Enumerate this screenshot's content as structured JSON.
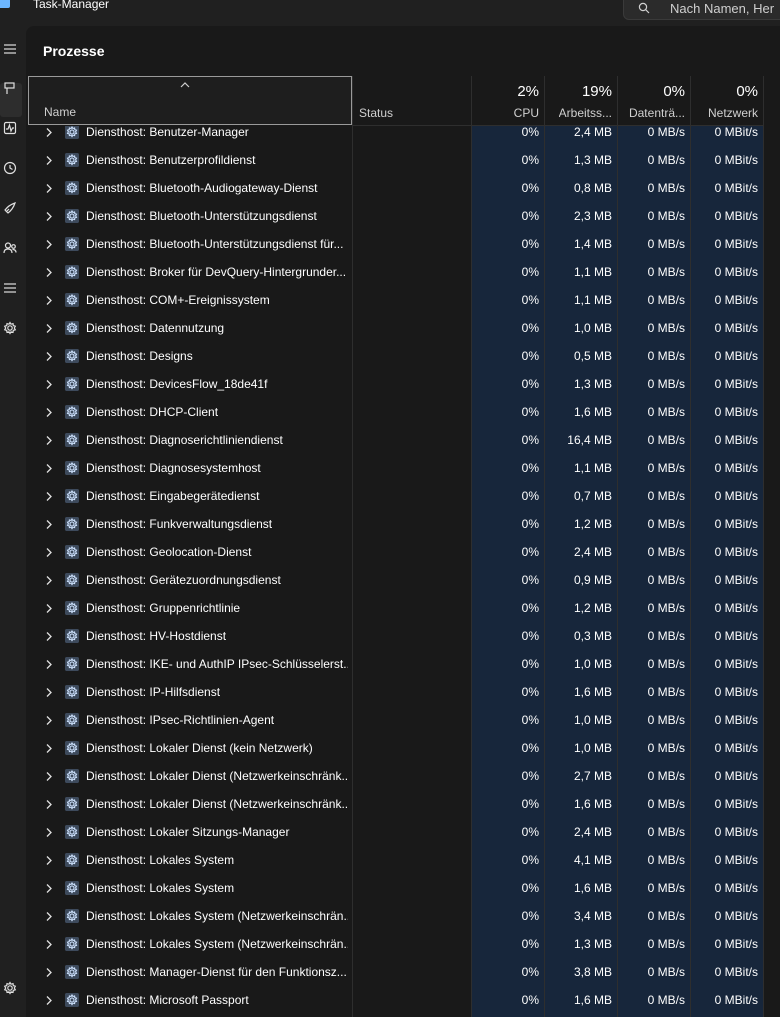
{
  "window": {
    "title": "Task-Manager"
  },
  "search": {
    "placeholder": "Nach Namen, Her"
  },
  "nav": {
    "items": [
      "menu",
      "processes",
      "performance",
      "app-history",
      "startup",
      "users",
      "details",
      "services"
    ],
    "settings": "settings"
  },
  "page": {
    "title": "Prozesse"
  },
  "columns": {
    "name": "Name",
    "status": "Status",
    "cpu": {
      "label": "CPU",
      "pct": "2%"
    },
    "memory": {
      "label": "Arbeitss...",
      "pct": "19%"
    },
    "disk": {
      "label": "Datenträ...",
      "pct": "0%"
    },
    "network": {
      "label": "Netzwerk",
      "pct": "0%"
    }
  },
  "colors": {
    "accent_metric_bg": "#17263b",
    "background": "#191919"
  },
  "rows": [
    {
      "name": "Diensthost: Benutzer-Manager",
      "cpu": "0%",
      "mem": "2,4 MB",
      "disk": "0 MB/s",
      "net": "0 MBit/s"
    },
    {
      "name": "Diensthost: Benutzerprofildienst",
      "cpu": "0%",
      "mem": "1,3 MB",
      "disk": "0 MB/s",
      "net": "0 MBit/s"
    },
    {
      "name": "Diensthost: Bluetooth-Audiogateway-Dienst",
      "cpu": "0%",
      "mem": "0,8 MB",
      "disk": "0 MB/s",
      "net": "0 MBit/s"
    },
    {
      "name": "Diensthost: Bluetooth-Unterstützungsdienst",
      "cpu": "0%",
      "mem": "2,3 MB",
      "disk": "0 MB/s",
      "net": "0 MBit/s"
    },
    {
      "name": "Diensthost: Bluetooth-Unterstützungsdienst für...",
      "cpu": "0%",
      "mem": "1,4 MB",
      "disk": "0 MB/s",
      "net": "0 MBit/s"
    },
    {
      "name": "Diensthost: Broker für DevQuery-Hintergrunder...",
      "cpu": "0%",
      "mem": "1,1 MB",
      "disk": "0 MB/s",
      "net": "0 MBit/s"
    },
    {
      "name": "Diensthost: COM+-Ereignissystem",
      "cpu": "0%",
      "mem": "1,1 MB",
      "disk": "0 MB/s",
      "net": "0 MBit/s"
    },
    {
      "name": "Diensthost: Datennutzung",
      "cpu": "0%",
      "mem": "1,0 MB",
      "disk": "0 MB/s",
      "net": "0 MBit/s"
    },
    {
      "name": "Diensthost: Designs",
      "cpu": "0%",
      "mem": "0,5 MB",
      "disk": "0 MB/s",
      "net": "0 MBit/s"
    },
    {
      "name": "Diensthost: DevicesFlow_18de41f",
      "cpu": "0%",
      "mem": "1,3 MB",
      "disk": "0 MB/s",
      "net": "0 MBit/s"
    },
    {
      "name": "Diensthost: DHCP-Client",
      "cpu": "0%",
      "mem": "1,6 MB",
      "disk": "0 MB/s",
      "net": "0 MBit/s"
    },
    {
      "name": "Diensthost: Diagnoserichtliniendienst",
      "cpu": "0%",
      "mem": "16,4 MB",
      "disk": "0 MB/s",
      "net": "0 MBit/s"
    },
    {
      "name": "Diensthost: Diagnosesystemhost",
      "cpu": "0%",
      "mem": "1,1 MB",
      "disk": "0 MB/s",
      "net": "0 MBit/s"
    },
    {
      "name": "Diensthost: Eingabegerätedienst",
      "cpu": "0%",
      "mem": "0,7 MB",
      "disk": "0 MB/s",
      "net": "0 MBit/s"
    },
    {
      "name": "Diensthost: Funkverwaltungsdienst",
      "cpu": "0%",
      "mem": "1,2 MB",
      "disk": "0 MB/s",
      "net": "0 MBit/s"
    },
    {
      "name": "Diensthost: Geolocation-Dienst",
      "cpu": "0%",
      "mem": "2,4 MB",
      "disk": "0 MB/s",
      "net": "0 MBit/s"
    },
    {
      "name": "Diensthost: Gerätezuordnungsdienst",
      "cpu": "0%",
      "mem": "0,9 MB",
      "disk": "0 MB/s",
      "net": "0 MBit/s"
    },
    {
      "name": "Diensthost: Gruppenrichtlinie",
      "cpu": "0%",
      "mem": "1,2 MB",
      "disk": "0 MB/s",
      "net": "0 MBit/s"
    },
    {
      "name": "Diensthost: HV-Hostdienst",
      "cpu": "0%",
      "mem": "0,3 MB",
      "disk": "0 MB/s",
      "net": "0 MBit/s"
    },
    {
      "name": "Diensthost: IKE- und AuthIP IPsec-Schlüsselerst...",
      "cpu": "0%",
      "mem": "1,0 MB",
      "disk": "0 MB/s",
      "net": "0 MBit/s"
    },
    {
      "name": "Diensthost: IP-Hilfsdienst",
      "cpu": "0%",
      "mem": "1,6 MB",
      "disk": "0 MB/s",
      "net": "0 MBit/s"
    },
    {
      "name": "Diensthost: IPsec-Richtlinien-Agent",
      "cpu": "0%",
      "mem": "1,0 MB",
      "disk": "0 MB/s",
      "net": "0 MBit/s"
    },
    {
      "name": "Diensthost: Lokaler Dienst (kein Netzwerk)",
      "cpu": "0%",
      "mem": "1,0 MB",
      "disk": "0 MB/s",
      "net": "0 MBit/s"
    },
    {
      "name": "Diensthost: Lokaler Dienst (Netzwerkeinschränk...",
      "cpu": "0%",
      "mem": "2,7 MB",
      "disk": "0 MB/s",
      "net": "0 MBit/s"
    },
    {
      "name": "Diensthost: Lokaler Dienst (Netzwerkeinschränk...",
      "cpu": "0%",
      "mem": "1,6 MB",
      "disk": "0 MB/s",
      "net": "0 MBit/s"
    },
    {
      "name": "Diensthost: Lokaler Sitzungs-Manager",
      "cpu": "0%",
      "mem": "2,4 MB",
      "disk": "0 MB/s",
      "net": "0 MBit/s"
    },
    {
      "name": "Diensthost: Lokales System",
      "cpu": "0%",
      "mem": "4,1 MB",
      "disk": "0 MB/s",
      "net": "0 MBit/s"
    },
    {
      "name": "Diensthost: Lokales System",
      "cpu": "0%",
      "mem": "1,6 MB",
      "disk": "0 MB/s",
      "net": "0 MBit/s"
    },
    {
      "name": "Diensthost: Lokales System (Netzwerkeinschrän...",
      "cpu": "0%",
      "mem": "3,4 MB",
      "disk": "0 MB/s",
      "net": "0 MBit/s"
    },
    {
      "name": "Diensthost: Lokales System (Netzwerkeinschrän...",
      "cpu": "0%",
      "mem": "1,3 MB",
      "disk": "0 MB/s",
      "net": "0 MBit/s"
    },
    {
      "name": "Diensthost: Manager-Dienst für den Funktionsz...",
      "cpu": "0%",
      "mem": "3,8 MB",
      "disk": "0 MB/s",
      "net": "0 MBit/s"
    },
    {
      "name": "Diensthost: Microsoft Passport",
      "cpu": "0%",
      "mem": "1,6 MB",
      "disk": "0 MB/s",
      "net": "0 MBit/s"
    }
  ]
}
